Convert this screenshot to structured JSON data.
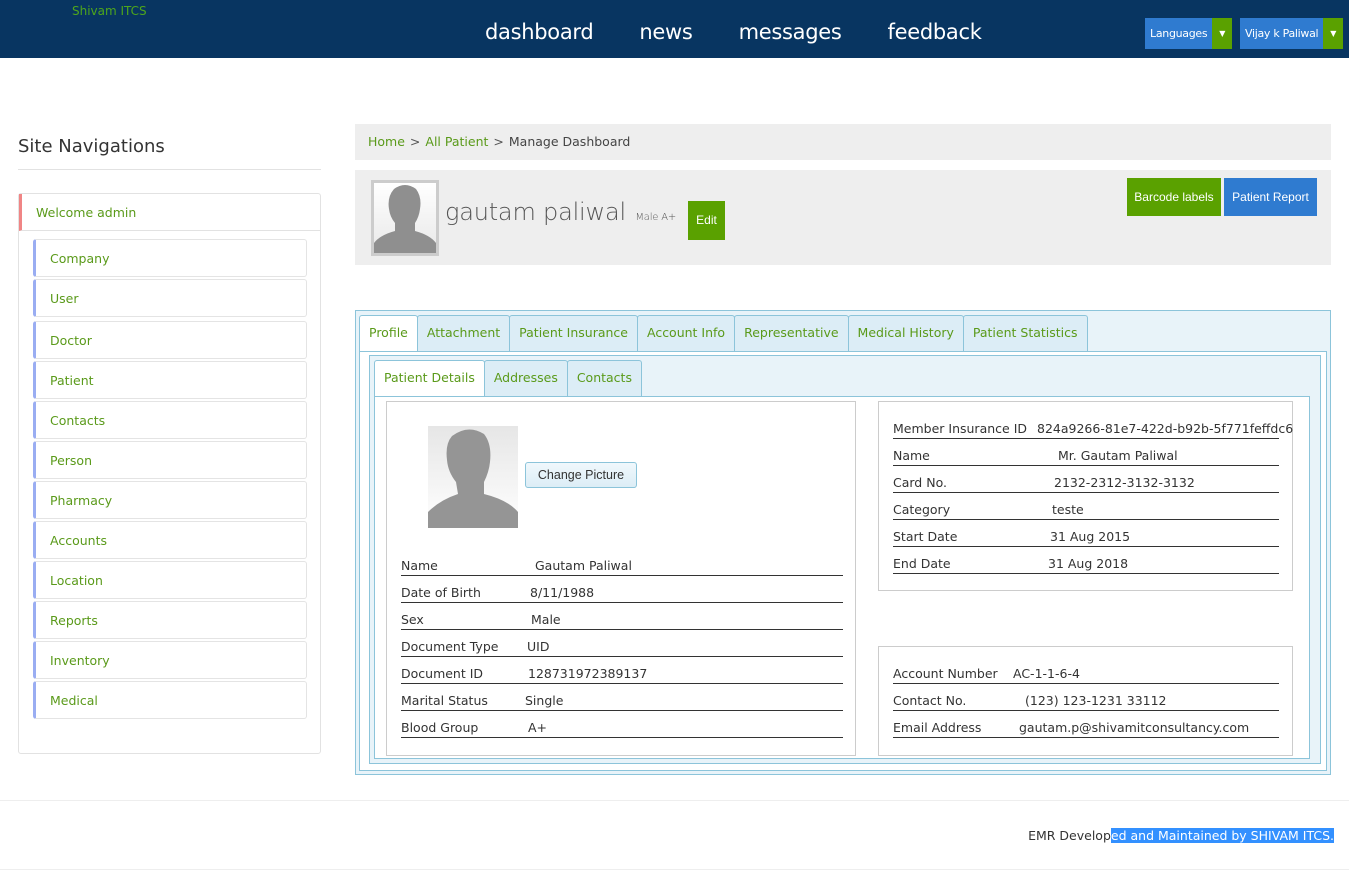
{
  "header": {
    "brand": "Shivam ITCS",
    "nav": [
      "dashboard",
      "news",
      "messages",
      "feedback"
    ],
    "languages_label": "Languages",
    "user_label": "Vijay k Paliwal",
    "colors": {
      "bar": "#083561",
      "blue_btn": "#2f7bd0",
      "green_btn": "#5aa100",
      "brand": "#4ea61c"
    }
  },
  "sidebar": {
    "title": "Site Navigations",
    "welcome": "Welcome admin",
    "items": [
      "Company",
      "User",
      "Doctor",
      "Patient",
      "Contacts",
      "Person",
      "Pharmacy",
      "Accounts",
      "Location",
      "Reports",
      "Inventory",
      "Medical"
    ]
  },
  "breadcrumb": {
    "home": "Home",
    "sep": ">",
    "all_patient": "All Patient",
    "current": "Manage Dashboard"
  },
  "patient": {
    "name": "gautam paliwal",
    "meta": "Male A+",
    "edit_label": "Edit",
    "barcode_label": "Barcode labels",
    "report_label": "Patient Report"
  },
  "tabs": [
    "Profile",
    "Attachment",
    "Patient Insurance",
    "Account Info",
    "Representative",
    "Medical History",
    "Patient Statistics"
  ],
  "active_tab": "Profile",
  "subtabs": [
    "Patient Details",
    "Addresses",
    "Contacts"
  ],
  "active_subtab": "Patient Details",
  "details": {
    "change_picture_label": "Change Picture",
    "rows": [
      {
        "label": "Name",
        "value": "Gautam Paliwal"
      },
      {
        "label": "Date of Birth",
        "value": "8/11/1988"
      },
      {
        "label": "Sex",
        "value": "Male"
      },
      {
        "label": "Document Type",
        "value": "UID"
      },
      {
        "label": "Document ID",
        "value": "128731972389137"
      },
      {
        "label": "Marital Status",
        "value": "Single"
      },
      {
        "label": "Blood Group",
        "value": "A+"
      }
    ]
  },
  "insurance": {
    "rows": [
      {
        "label": "Member Insurance ID",
        "value": "824a9266-81e7-422d-b92b-5f771feffdc6"
      },
      {
        "label": "Name",
        "value": "Mr. Gautam Paliwal"
      },
      {
        "label": "Card No.",
        "value": "2132-2312-3132-3132"
      },
      {
        "label": "Category",
        "value": "teste"
      },
      {
        "label": "Start Date",
        "value": "31 Aug 2015"
      },
      {
        "label": "End Date",
        "value": "31 Aug 2018"
      }
    ]
  },
  "account": {
    "rows": [
      {
        "label": "Account Number",
        "value": "AC-1-1-6-4"
      },
      {
        "label": "Contact No.",
        "value": "(123) 123-1231 33112"
      },
      {
        "label": "Email Address",
        "value": "gautam.p@shivamitconsultancy.com"
      }
    ]
  },
  "footer": {
    "text_plain": "EMR Develop",
    "text_selected": "ed and Maintained by SHIVAM ITCS."
  }
}
